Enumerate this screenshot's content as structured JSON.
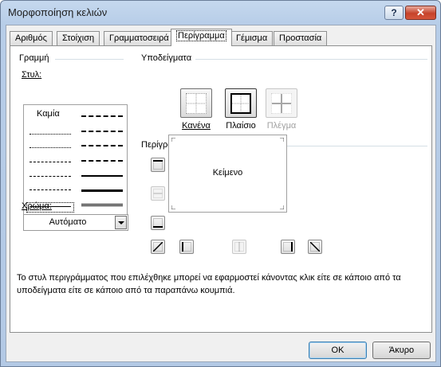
{
  "window": {
    "title": "Μορφοποίηση κελιών",
    "help_label": "?",
    "close_label": "✕"
  },
  "tabs": [
    "Αριθμός",
    "Στοίχιση",
    "Γραμματοσειρά",
    "Περίγραμμα",
    "Γέμισμα",
    "Προστασία"
  ],
  "active_tab": "Περίγραμμα",
  "line": {
    "section": "Γραμμή",
    "style_label": "Στυλ:",
    "none_option": "Καμία",
    "color_label": "Χρώμα:",
    "color_value": "Αυτόματο"
  },
  "presets": {
    "section": "Υποδείγματα",
    "items": [
      {
        "label": "Κανένα",
        "enabled": true
      },
      {
        "label": "Πλαίσιο",
        "enabled": true
      },
      {
        "label": "Πλέγμα",
        "enabled": false
      }
    ]
  },
  "border": {
    "section": "Περίγραμμα",
    "preview_text": "Κείμενο"
  },
  "description": "Το στυλ περιγράμματος που επιλέχθηκε μπορεί να εφαρμοστεί κάνοντας κλικ είτε σε κάποιο από τα υποδείγματα είτε σε κάποιο από τα παραπάνω κουμπιά.",
  "buttons": {
    "ok": "OK",
    "cancel": "Άκυρο"
  }
}
